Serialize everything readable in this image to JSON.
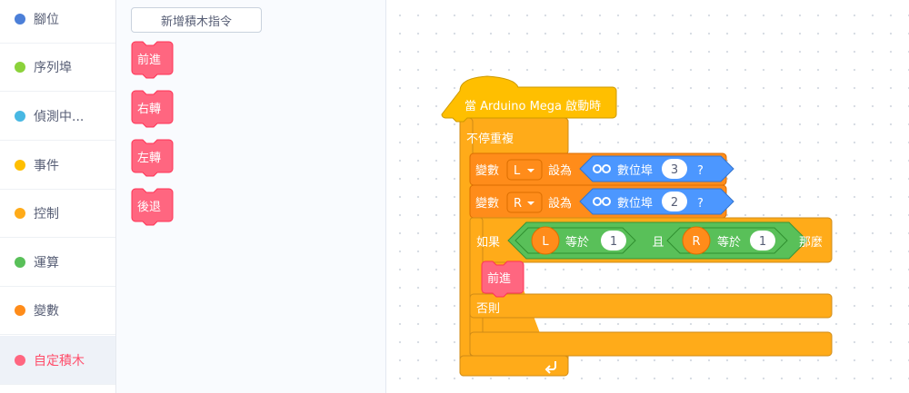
{
  "categories": [
    {
      "label": "腳位",
      "color": "#4c7fd8"
    },
    {
      "label": "序列埠",
      "color": "#8bd23a"
    },
    {
      "label": "偵測中...",
      "color": "#48b8e3"
    },
    {
      "label": "事件",
      "color": "#ffbf00"
    },
    {
      "label": "控制",
      "color": "#ffab19"
    },
    {
      "label": "運算",
      "color": "#59c059"
    },
    {
      "label": "變數",
      "color": "#ff8c1a"
    },
    {
      "label": "自定積木",
      "color": "#ff6680"
    }
  ],
  "flyout": {
    "make_block_label": "新增積木指令",
    "blocks": [
      "前進",
      "右轉",
      "左轉",
      "後退"
    ]
  },
  "script": {
    "hat": "當 Arduino Mega 啟動時",
    "forever": "不停重複",
    "set_l": {
      "keyword": "變數",
      "var": "L",
      "set_to": "設為",
      "reporter": "數位埠",
      "pin": "3",
      "q": "?"
    },
    "set_r": {
      "keyword": "變數",
      "var": "R",
      "set_to": "設為",
      "reporter": "數位埠",
      "pin": "2",
      "q": "?"
    },
    "if_else": {
      "if_label": "如果",
      "cond1": {
        "var": "L",
        "op": "等於",
        "value": "1"
      },
      "and_label": "且",
      "cond2": {
        "var": "R",
        "op": "等於",
        "value": "1"
      },
      "then_label": "那麼",
      "then_call": "前進",
      "else_label": "否則"
    }
  },
  "colors": {
    "custom": "#ff6680",
    "custom_dark": "#ff3355",
    "event": "#ffbf00",
    "control": "#ffab19",
    "variable": "#ff8c1a",
    "operator": "#59c059",
    "sensor": "#4c97ff",
    "sidebar_active_text": "#ff4d6a"
  }
}
